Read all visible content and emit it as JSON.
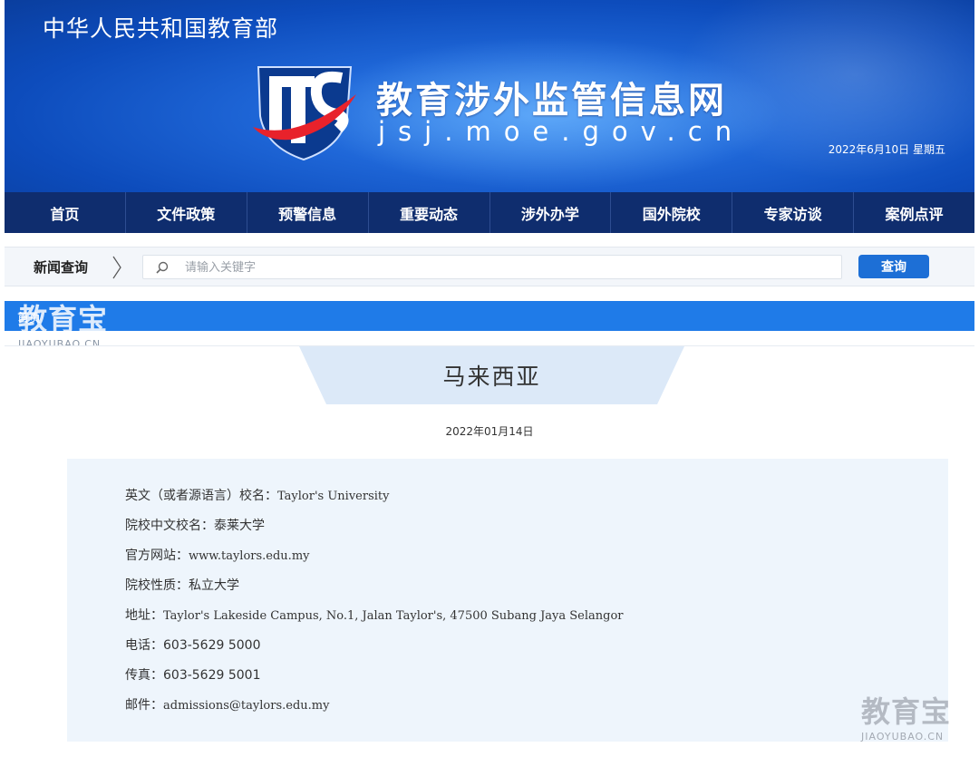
{
  "header": {
    "ministry": "中华人民共和国教育部",
    "site_title": "教育涉外监管信息网",
    "site_domain": "jsj.moe.gov.cn",
    "date": "2022年6月10日 星期五"
  },
  "nav": {
    "items": [
      {
        "label": "首页"
      },
      {
        "label": "文件政策"
      },
      {
        "label": "预警信息"
      },
      {
        "label": "重要动态"
      },
      {
        "label": "涉外办学"
      },
      {
        "label": "国外院校"
      },
      {
        "label": "专家访谈"
      },
      {
        "label": "案例点评"
      }
    ]
  },
  "search": {
    "label": "新闻查询",
    "placeholder": "请输入关键字",
    "button": "查询"
  },
  "breadcrumb": {
    "home": "首页"
  },
  "watermark": {
    "brand": "教育宝",
    "url": "JIAOYUBAO.CN"
  },
  "article": {
    "title": "马来西亚",
    "date": "2022年01月14日",
    "fields": [
      {
        "label": "英文（或者源语言）校名：",
        "value": "Taylor's University"
      },
      {
        "label": "院校中文校名：",
        "value": "泰莱大学"
      },
      {
        "label": "官方网站：",
        "value": "www.taylors.edu.my"
      },
      {
        "label": "院校性质：",
        "value": "私立大学"
      },
      {
        "label": "地址：",
        "value": "Taylor's Lakeside Campus, No.1, Jalan Taylor's, 47500 Subang Jaya Selangor"
      },
      {
        "label": "电话：",
        "value": "603-5629 5000"
      },
      {
        "label": "传真：",
        "value": "603-5629 5001"
      },
      {
        "label": "邮件：",
        "value": "admissions@taylors.edu.my"
      }
    ]
  },
  "colors": {
    "banner_blue": "#1f67d8",
    "nav_navy": "#0f2d6e",
    "crumb_blue": "#1f7be8",
    "button_blue": "#1d6fd6",
    "content_bg": "#eef5fc",
    "logo_red": "#e8222b"
  }
}
